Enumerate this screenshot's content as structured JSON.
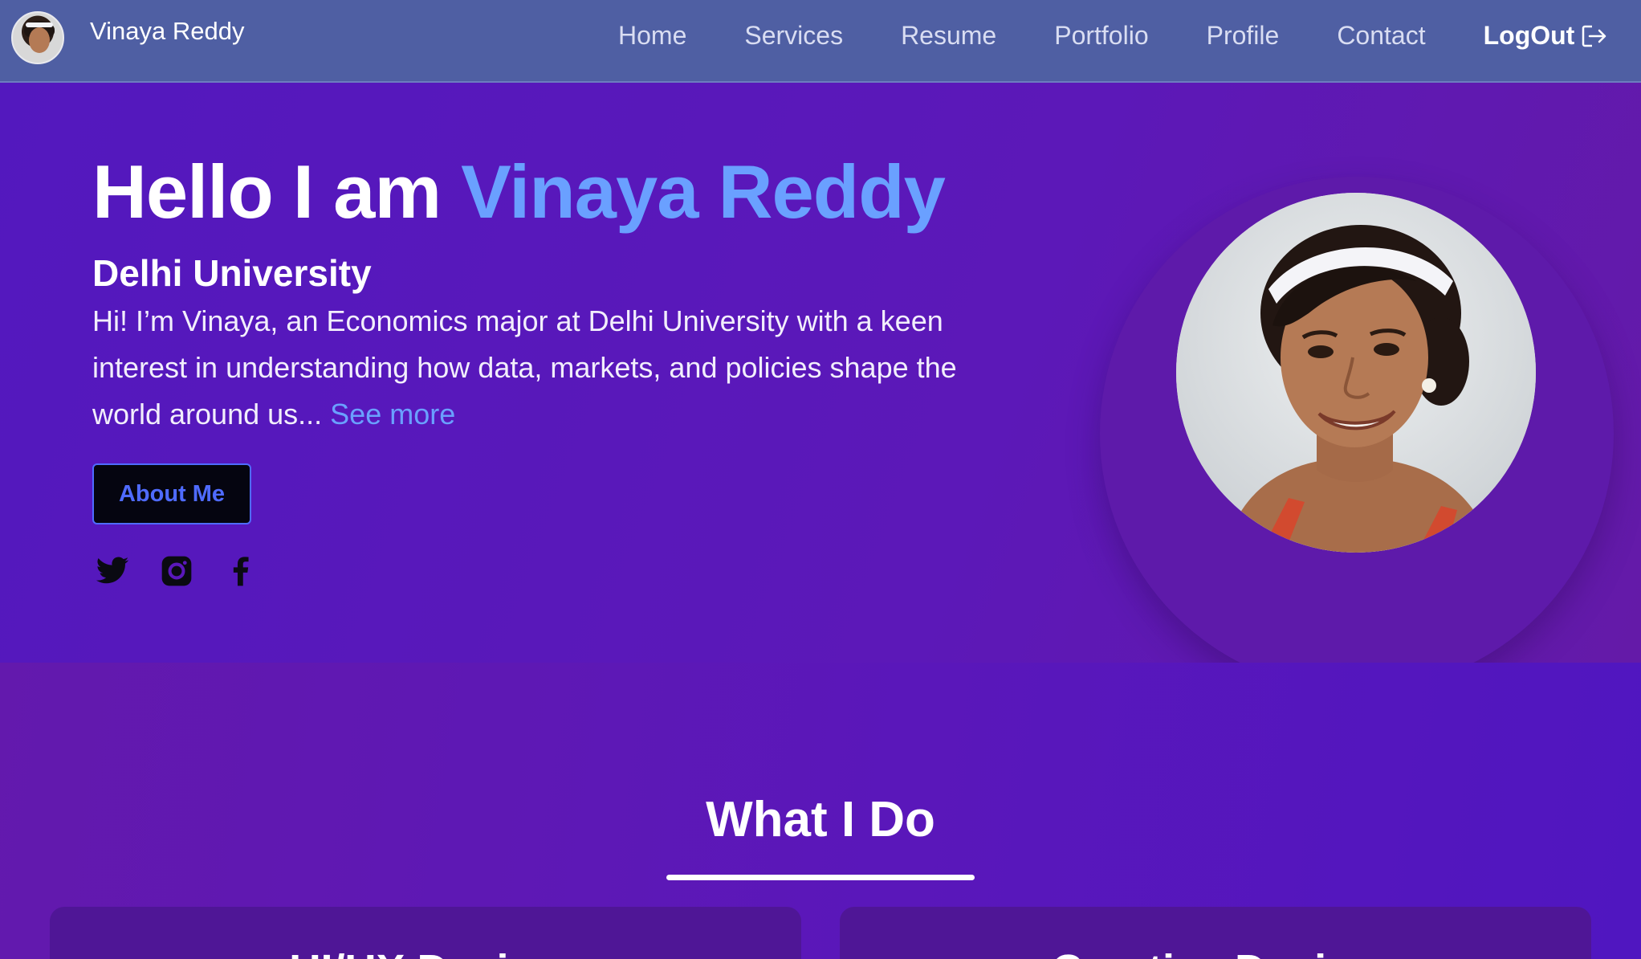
{
  "brand": {
    "name": "Vinaya Reddy"
  },
  "nav": {
    "items": [
      "Home",
      "Services",
      "Resume",
      "Portfolio",
      "Profile",
      "Contact"
    ],
    "logout_label": "LogOut"
  },
  "hero": {
    "greeting": "Hello I am ",
    "name": "Vinaya Reddy",
    "subtitle": "Delhi University",
    "bio": "Hi! I’m Vinaya, an Economics major at Delhi University with a keen interest in understanding how data, markets, and policies shape the world around us... ",
    "see_more": "See more",
    "about_button": "About Me",
    "socials": [
      "twitter-icon",
      "instagram-icon",
      "facebook-icon"
    ]
  },
  "services": {
    "title": "What I Do",
    "cards": [
      "UI/UX Design",
      "Creative Design"
    ]
  },
  "colors": {
    "navbar": "#4f5fa3",
    "hero_bg": "#5a18bb",
    "accent": "#6aa0ff",
    "button_border": "#4f6bff"
  }
}
